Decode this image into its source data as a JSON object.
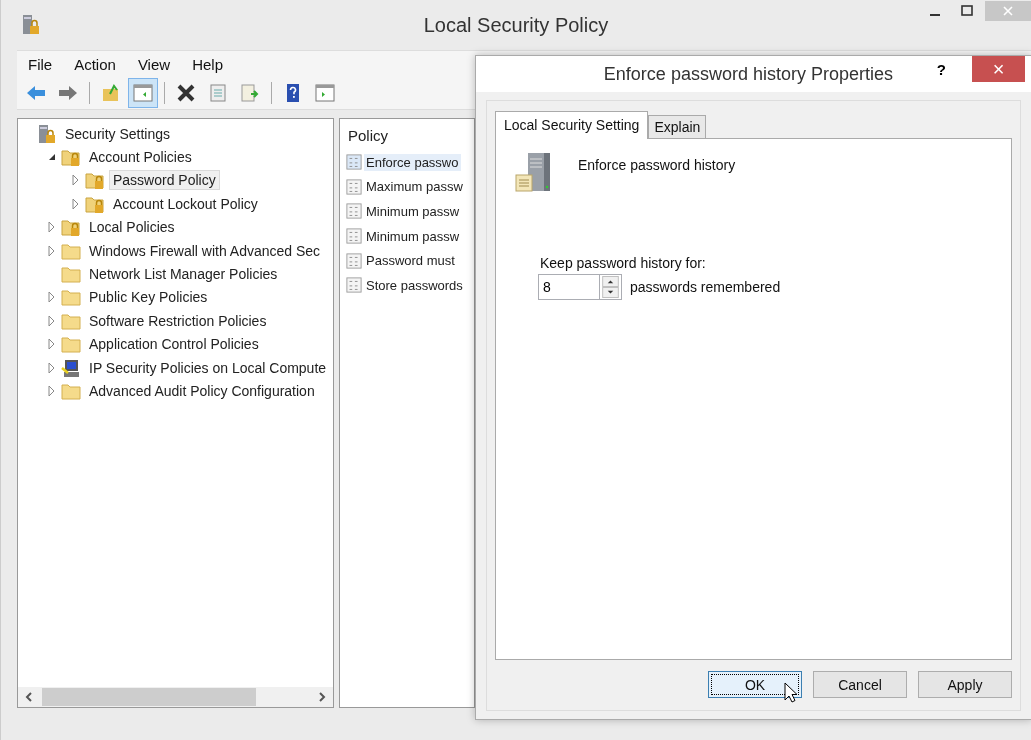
{
  "window": {
    "title": "Local Security Policy"
  },
  "menu": [
    "File",
    "Action",
    "View",
    "Help"
  ],
  "toolbar": [
    [
      {
        "kind": "back",
        "selected": false
      },
      {
        "kind": "forward",
        "selected": false
      }
    ],
    [
      {
        "kind": "up",
        "selected": false
      },
      {
        "kind": "tree",
        "selected": true
      }
    ],
    [
      {
        "kind": "delete",
        "selected": false
      },
      {
        "kind": "properties",
        "selected": false
      },
      {
        "kind": "export",
        "selected": false
      }
    ],
    [
      {
        "kind": "help",
        "selected": false
      },
      {
        "kind": "pane",
        "selected": false
      }
    ]
  ],
  "tree": [
    {
      "label": "Security Settings",
      "kind": "server",
      "selected": false,
      "children": [
        {
          "label": "Account Policies",
          "kind": "lockfolder",
          "expanded": true,
          "selected": false,
          "children": [
            {
              "label": "Password Policy",
              "kind": "lockfolder",
              "expanded": false,
              "selected": true
            },
            {
              "label": "Account Lockout Policy",
              "kind": "lockfolder",
              "expanded": false,
              "selected": false
            }
          ]
        },
        {
          "label": "Local Policies",
          "kind": "lockfolder",
          "expanded": false,
          "selected": false
        },
        {
          "label": "Windows Firewall with Advanced Sec",
          "kind": "folder",
          "expanded": false,
          "selected": false
        },
        {
          "label": "Network List Manager Policies",
          "kind": "folder",
          "selected": false
        },
        {
          "label": "Public Key Policies",
          "kind": "folder",
          "expanded": false,
          "selected": false
        },
        {
          "label": "Software Restriction Policies",
          "kind": "folder",
          "expanded": false,
          "selected": false
        },
        {
          "label": "Application Control Policies",
          "kind": "folder",
          "expanded": false,
          "selected": false
        },
        {
          "label": "IP Security Policies on Local Compute",
          "kind": "computer",
          "expanded": false,
          "selected": false
        },
        {
          "label": "Advanced Audit Policy Configuration",
          "kind": "folder",
          "expanded": false,
          "selected": false
        }
      ]
    }
  ],
  "policy_list": {
    "column": "Policy",
    "items": [
      {
        "label": "Enforce passwo",
        "selected": true
      },
      {
        "label": "Maximum passw",
        "selected": false
      },
      {
        "label": "Minimum passw",
        "selected": false
      },
      {
        "label": "Minimum passw",
        "selected": false
      },
      {
        "label": "Password must",
        "selected": false
      },
      {
        "label": "Store passwords",
        "selected": false
      }
    ]
  },
  "dialog": {
    "title": "Enforce password history Properties",
    "help": "?",
    "close": "×",
    "tabs": [
      {
        "label": "Local Security Setting",
        "selected": true
      },
      {
        "label": "Explain",
        "selected": false
      }
    ],
    "heading": "Enforce password history",
    "field_label": "Keep password history for:",
    "value": "8",
    "unit": "passwords remembered",
    "buttons": [
      {
        "label": "OK",
        "default": true
      },
      {
        "label": "Cancel",
        "default": false
      },
      {
        "label": "Apply",
        "default": false
      }
    ]
  }
}
